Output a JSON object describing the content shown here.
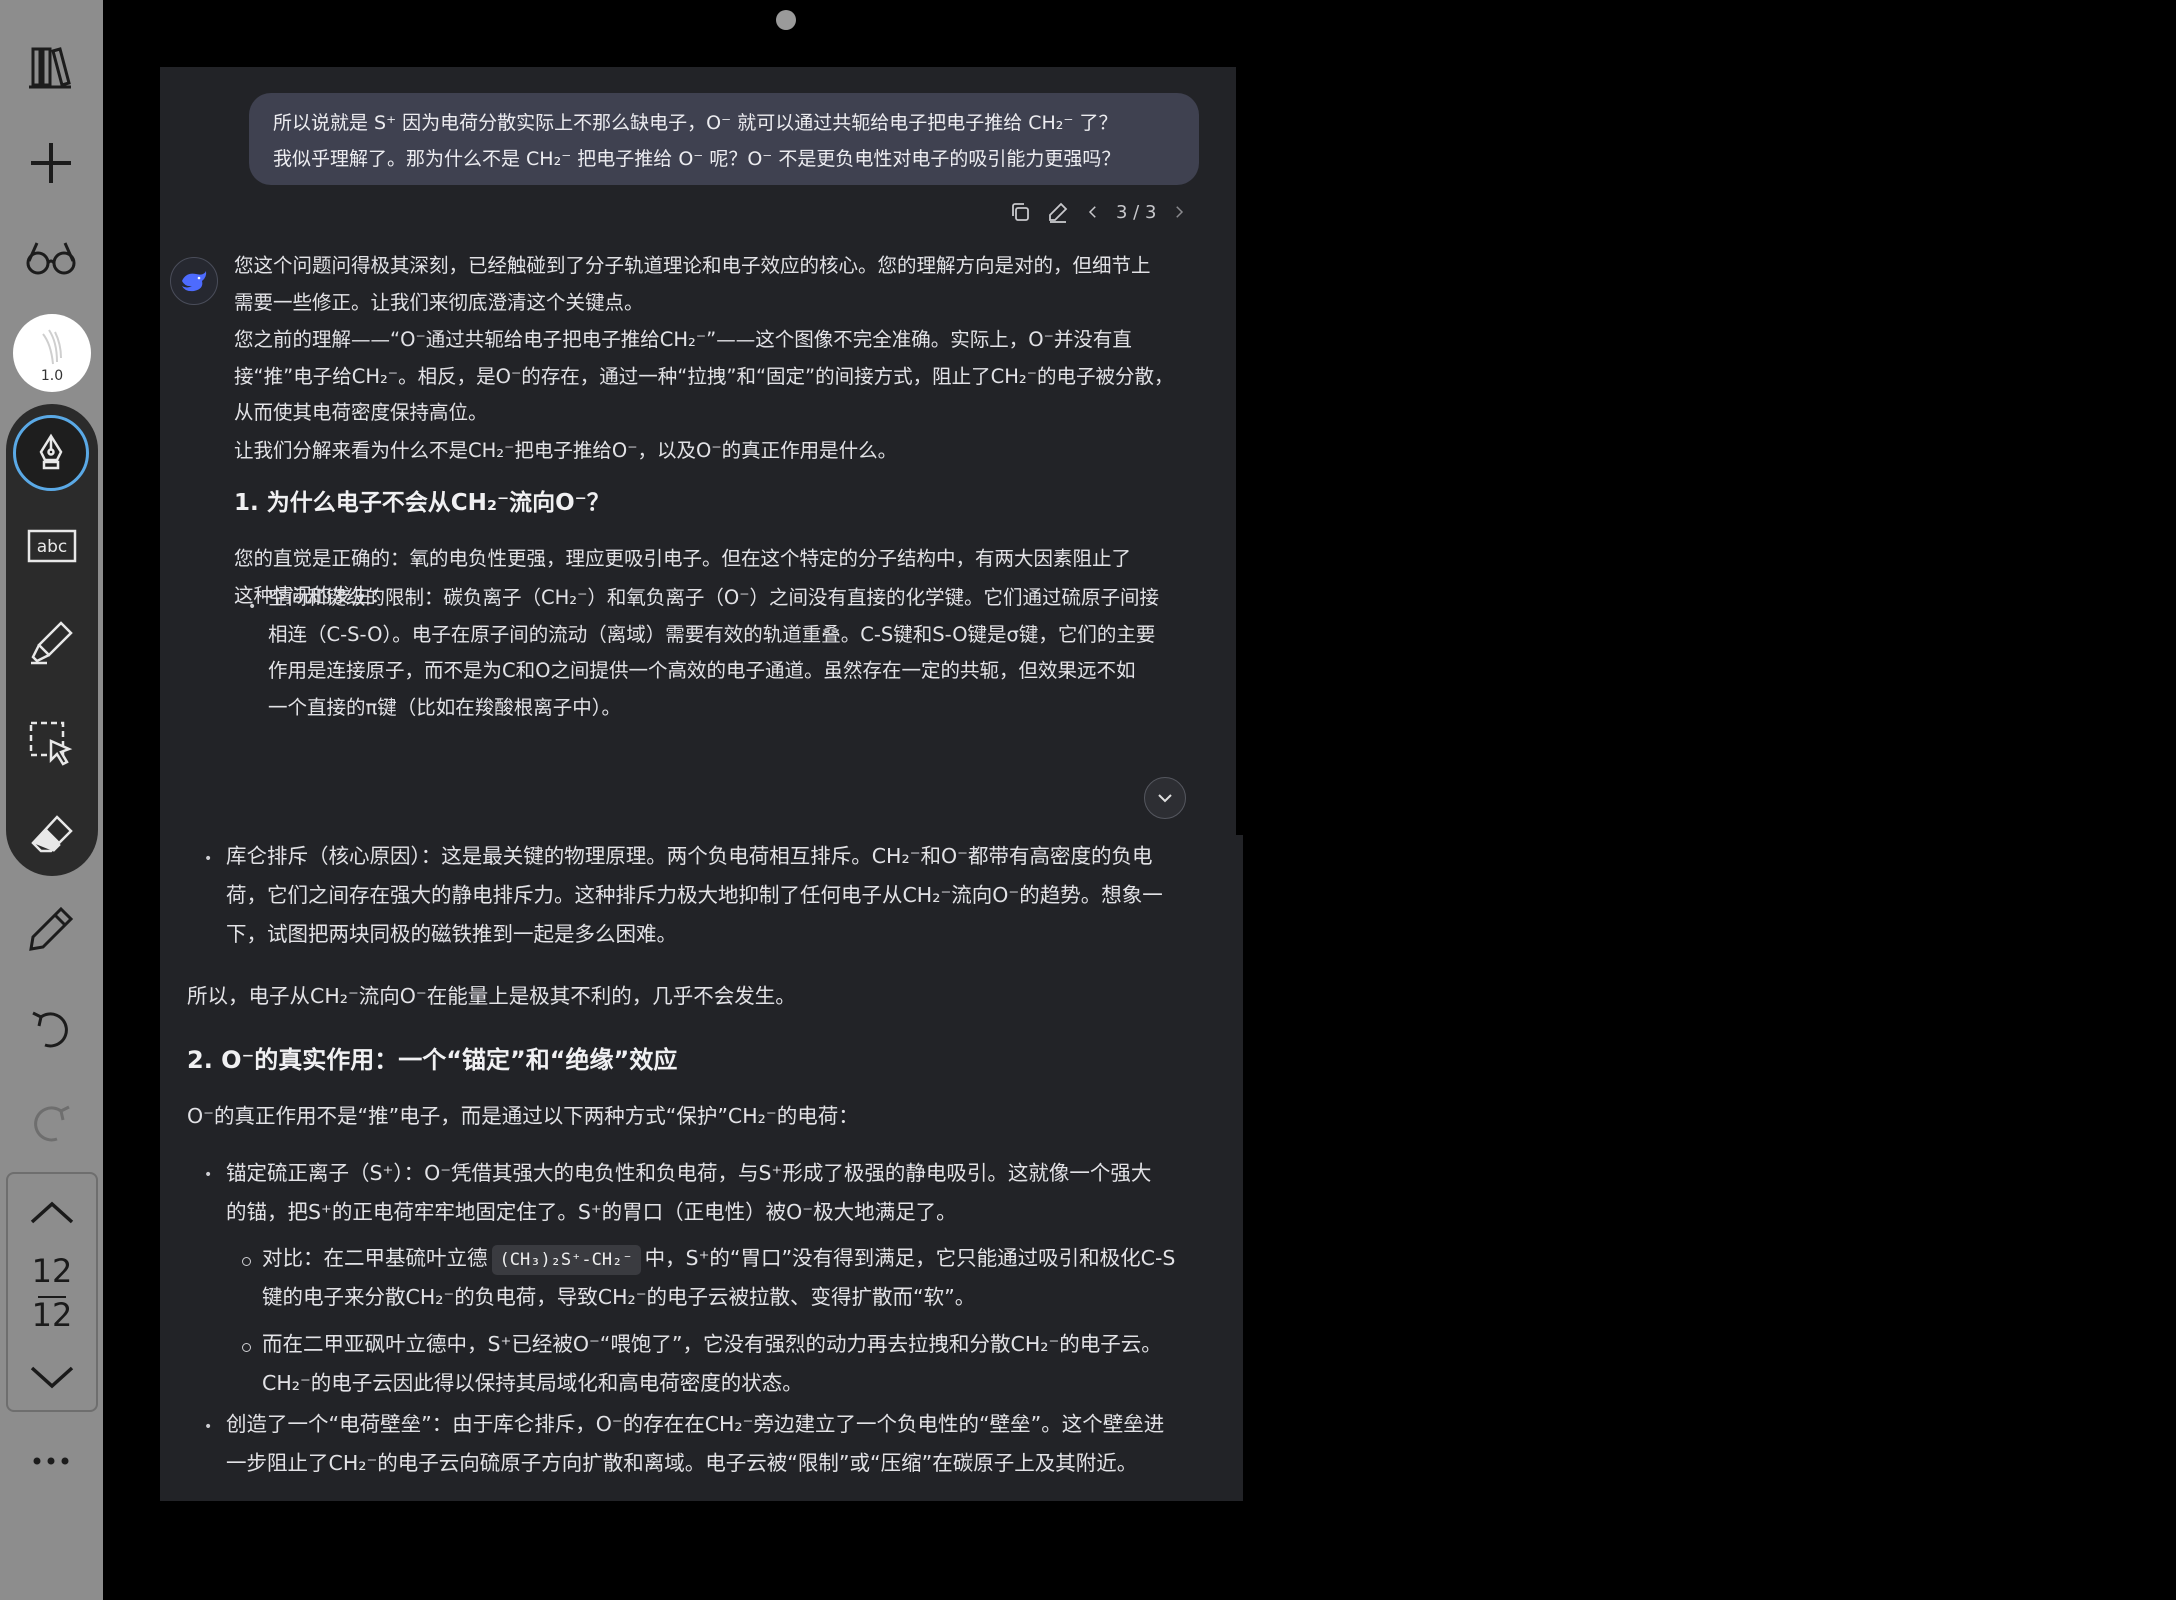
{
  "toolbar": {
    "brush_size": "1.0",
    "page_current": "12",
    "page_total": "12"
  },
  "chat": {
    "user_message_line1": "所以说就是 S⁺ 因为电荷分散实际上不那么缺电子，O⁻ 就可以通过共轭给电子把电子推给 CH₂⁻ 了？",
    "user_message_line2": "我似乎理解了。那为什么不是 CH₂⁻ 把电子推给 O⁻ 呢？O⁻ 不是更负电性对电子的吸引能力更强吗？",
    "page_indicator": "3 / 3",
    "top": {
      "p1_l1": "您这个问题问得极其深刻，已经触碰到了分子轨道理论和电子效应的核心。您的理解方向是对的，但细节上",
      "p1_l2": "需要一些修正。让我们来彻底澄清这个关键点。",
      "p2_l1": "您之前的理解——“O⁻通过共轭给电子把电子推给CH₂⁻”——这个图像不完全准确。实际上，O⁻并没有直",
      "p2_l2": "接“推”电子给CH₂⁻。相反，是O⁻的存在，通过一种“拉拽”和“固定”的间接方式，阻止了CH₂⁻的电子被分散，",
      "p2_l3": "从而使其电荷密度保持高位。",
      "p3": "让我们分解来看为什么不是CH₂⁻把电子推给O⁻，以及O⁻的真正作用是什么。",
      "h1": "1. 为什么电子不会从CH₂⁻流向O⁻？",
      "p4_l1": "您的直觉是正确的：氧的电负性更强，理应更吸引电子。但在这个特定的分子结构中，有两大因素阻止了",
      "p4_l2": "这种情况的发生：",
      "b1_l1": "空间和键级的限制：碳负离子（CH₂⁻）和氧负离子（O⁻）之间没有直接的化学键。它们通过硫原子间接",
      "b1_l2": "相连（C-S-O）。电子在原子间的流动（离域）需要有效的轨道重叠。C-S键和S-O键是σ键，它们的主要",
      "b1_l3": "作用是连接原子，而不是为C和O之间提供一个高效的电子通道。虽然存在一定的共轭，但效果远不如",
      "b1_l4": "一个直接的π键（比如在羧酸根离子中）。"
    },
    "bottom": {
      "b2_l1": "库仑排斥（核心原因）：这是最关键的物理原理。两个负电荷相互排斥。CH₂⁻和O⁻都带有高密度的负电",
      "b2_l2": "荷，它们之间存在强大的静电排斥力。这种排斥力极大地抑制了任何电子从CH₂⁻流向O⁻的趋势。想象一",
      "b2_l3": "下，试图把两块同极的磁铁推到一起是多么困难。",
      "p5": "所以，电子从CH₂⁻流向O⁻在能量上是极其不利的，几乎不会发生。",
      "h2": "2. O⁻的真实作用：一个“锚定”和“绝缘”效应",
      "p6": "O⁻的真正作用不是“推”电子，而是通过以下两种方式“保护”CH₂⁻的电荷：",
      "b3_l1": "锚定硫正离子（S⁺）：O⁻凭借其强大的电负性和负电荷，与S⁺形成了极强的静电吸引。这就像一个强大",
      "b3_l2": "的锚，把S⁺的正电荷牢牢地固定住了。S⁺的胃口（正电性）被O⁻极大地满足了。",
      "s1_pre": "对比：在二甲基硫叶立德",
      "s1_code": "(CH₃)₂S⁺-CH₂⁻",
      "s1_post": "中，S⁺的“胃口”没有得到满足，它只能通过吸引和极化C-S",
      "s1_l2": "键的电子来分散CH₂⁻的负电荷，导致CH₂⁻的电子云被拉散、变得扩散而“软”。",
      "s2_l1": "而在二甲亚砜叶立德中，S⁺已经被O⁻“喂饱了”，它没有强烈的动力再去拉拽和分散CH₂⁻的电子云。",
      "s2_l2": "CH₂⁻的电子云因此得以保持其局域化和高电荷密度的状态。",
      "b4_l1": "创造了一个“电荷壁垒”：由于库仑排斥，O⁻的存在在CH₂⁻旁边建立了一个负电性的“壁垒”。这个壁垒进",
      "b4_l2": "一步阻止了CH₂⁻的电子云向硫原子方向扩散和离域。电子云被“限制”或“压缩”在碳原子上及其附近。"
    }
  }
}
